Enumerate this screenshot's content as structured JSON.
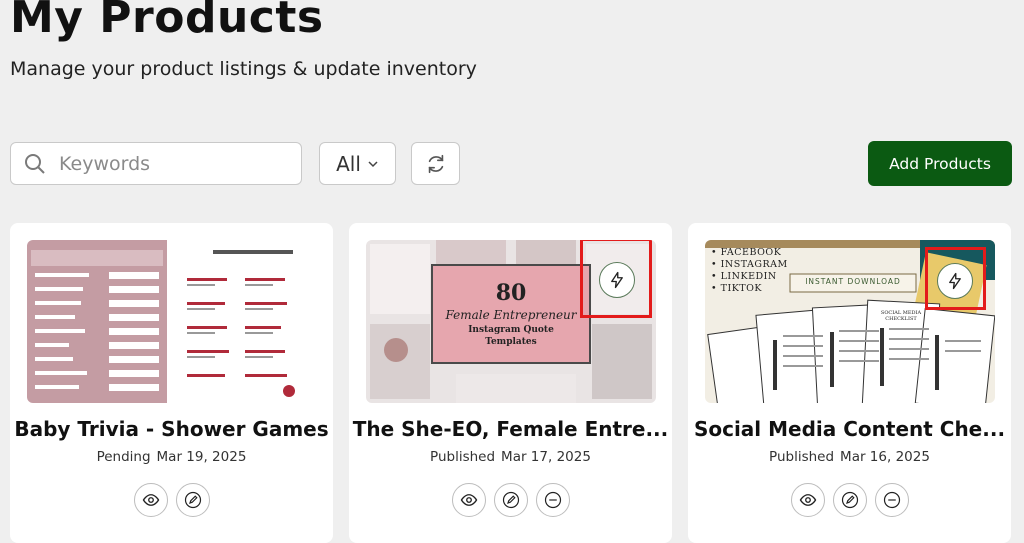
{
  "header": {
    "title": "My Products",
    "subtitle": "Manage your product listings & update inventory"
  },
  "toolbar": {
    "search_placeholder": "Keywords",
    "filter_value": "All",
    "add_label": "Add Products"
  },
  "products": [
    {
      "title": "Baby Trivia - Shower Games",
      "status": "Pending",
      "date": "Mar 19, 2025"
    },
    {
      "title": "The She-EO, Female Entre...",
      "status": "Published",
      "date": "Mar 17, 2025"
    },
    {
      "title": "Social Media Content Che...",
      "status": "Published",
      "date": "Mar 16, 2025"
    }
  ],
  "thumb2": {
    "number": "80",
    "script": "Female Entrepreneur",
    "subtitle": "Instagram Quote Templates"
  },
  "thumb3": {
    "platforms": [
      "• FACEBOOK",
      "• INSTAGRAM",
      "• LINKEDIN",
      "• TIKTOK"
    ],
    "badge": "INSTANT DOWNLOAD",
    "sheet_title": "SOCIAL MEDIA CHECKLIST"
  },
  "colors": {
    "accent_green": "#0b5a12",
    "highlight_red": "#e31b1b",
    "baby_pink": "#c49ca3"
  }
}
